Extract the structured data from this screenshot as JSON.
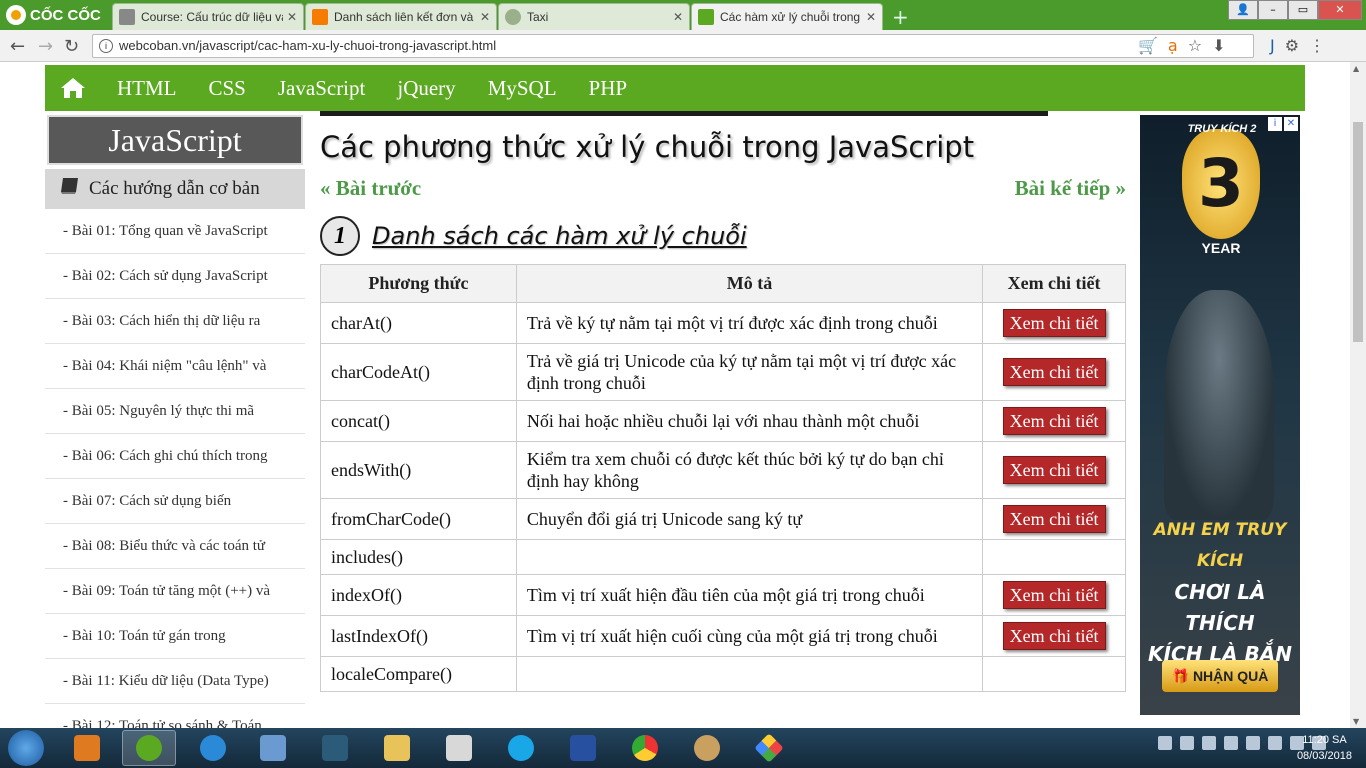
{
  "browser": {
    "brand": "CỐC CỐC",
    "tabs": [
      {
        "label": "Course: Cấu trúc dữ liệu và giải thuật",
        "color": "#888888"
      },
      {
        "label": "Danh sách liên kết đơn và",
        "color": "#f57c00"
      },
      {
        "label": "Taxi",
        "color": "#9ab08a"
      },
      {
        "label": "Các hàm xử lý chuỗi trong",
        "color": "#5aa921"
      }
    ],
    "url": "webcoban.vn/javascript/cac-ham-xu-ly-chuoi-trong-javascript.html"
  },
  "nav": {
    "items": [
      "HTML",
      "CSS",
      "JavaScript",
      "jQuery",
      "MySQL",
      "PHP"
    ]
  },
  "sidebar": {
    "title": "JavaScript",
    "section": "Các hướng dẫn cơ bản",
    "lessons": [
      "- Bài 01: Tổng quan về JavaScript",
      "- Bài 02: Cách sử dụng JavaScript",
      "- Bài 03: Cách hiển thị dữ liệu ra",
      "- Bài 04: Khái niệm \"câu lệnh\" và",
      "- Bài 05: Nguyên lý thực thi mã",
      "- Bài 06: Cách ghi chú thích trong",
      "- Bài 07: Cách sử dụng biến",
      "- Bài 08: Biểu thức và các toán tử",
      "- Bài 09: Toán tử tăng một (++) và",
      "- Bài 10: Toán tử gán trong",
      "- Bài 11: Kiểu dữ liệu (Data Type)",
      "- Bài 12: Toán tử so sánh & Toán"
    ]
  },
  "main": {
    "title": "Các phương thức xử lý chuỗi trong JavaScript",
    "prev_label": "Bài trước",
    "next_label": "Bài kế tiếp",
    "section_number": "1",
    "section_title": "Danh sách các hàm xử lý chuỗi",
    "table": {
      "headers": [
        "Phương thức",
        "Mô tả",
        "Xem chi tiết"
      ],
      "button_label": "Xem chi tiết",
      "rows": [
        {
          "method": "charAt()",
          "desc": "Trả về ký tự nằm tại một vị trí được xác định trong chuỗi",
          "btn": true
        },
        {
          "method": "charCodeAt()",
          "desc": "Trả về giá trị Unicode của ký tự nằm tại một vị trí được xác định trong chuỗi",
          "btn": true
        },
        {
          "method": "concat()",
          "desc": "Nối hai hoặc nhiều chuỗi lại với nhau thành một chuỗi",
          "btn": true
        },
        {
          "method": "endsWith()",
          "desc": "Kiểm tra xem chuỗi có được kết thúc bởi ký tự do bạn chỉ định hay không",
          "btn": true
        },
        {
          "method": "fromCharCode()",
          "desc": "Chuyển đổi giá trị Unicode sang ký tự",
          "btn": true
        },
        {
          "method": "includes()",
          "desc": "",
          "btn": false
        },
        {
          "method": "indexOf()",
          "desc": "Tìm vị trí xuất hiện đầu tiên của một giá trị trong chuỗi",
          "btn": true
        },
        {
          "method": "lastIndexOf()",
          "desc": "Tìm vị trí xuất hiện cuối cùng của một giá trị trong chuỗi",
          "btn": true
        },
        {
          "method": "localeCompare()",
          "desc": "",
          "btn": false
        }
      ]
    }
  },
  "ad": {
    "brand": "TRUY KÍCH 2",
    "number": "3",
    "year": "YEAR",
    "slogan": [
      "ANH EM TRUY KÍCH",
      "CHƠI LÀ THÍCH",
      "KÍCH LÀ BẮN"
    ],
    "cta": "NHẬN QUÀ"
  },
  "taskbar": {
    "time": "11:20 SA",
    "date": "08/03/2018"
  },
  "colors": {
    "nav_green": "#5aa921",
    "button_red": "#b4282a",
    "pager_green": "#4c9a48"
  }
}
